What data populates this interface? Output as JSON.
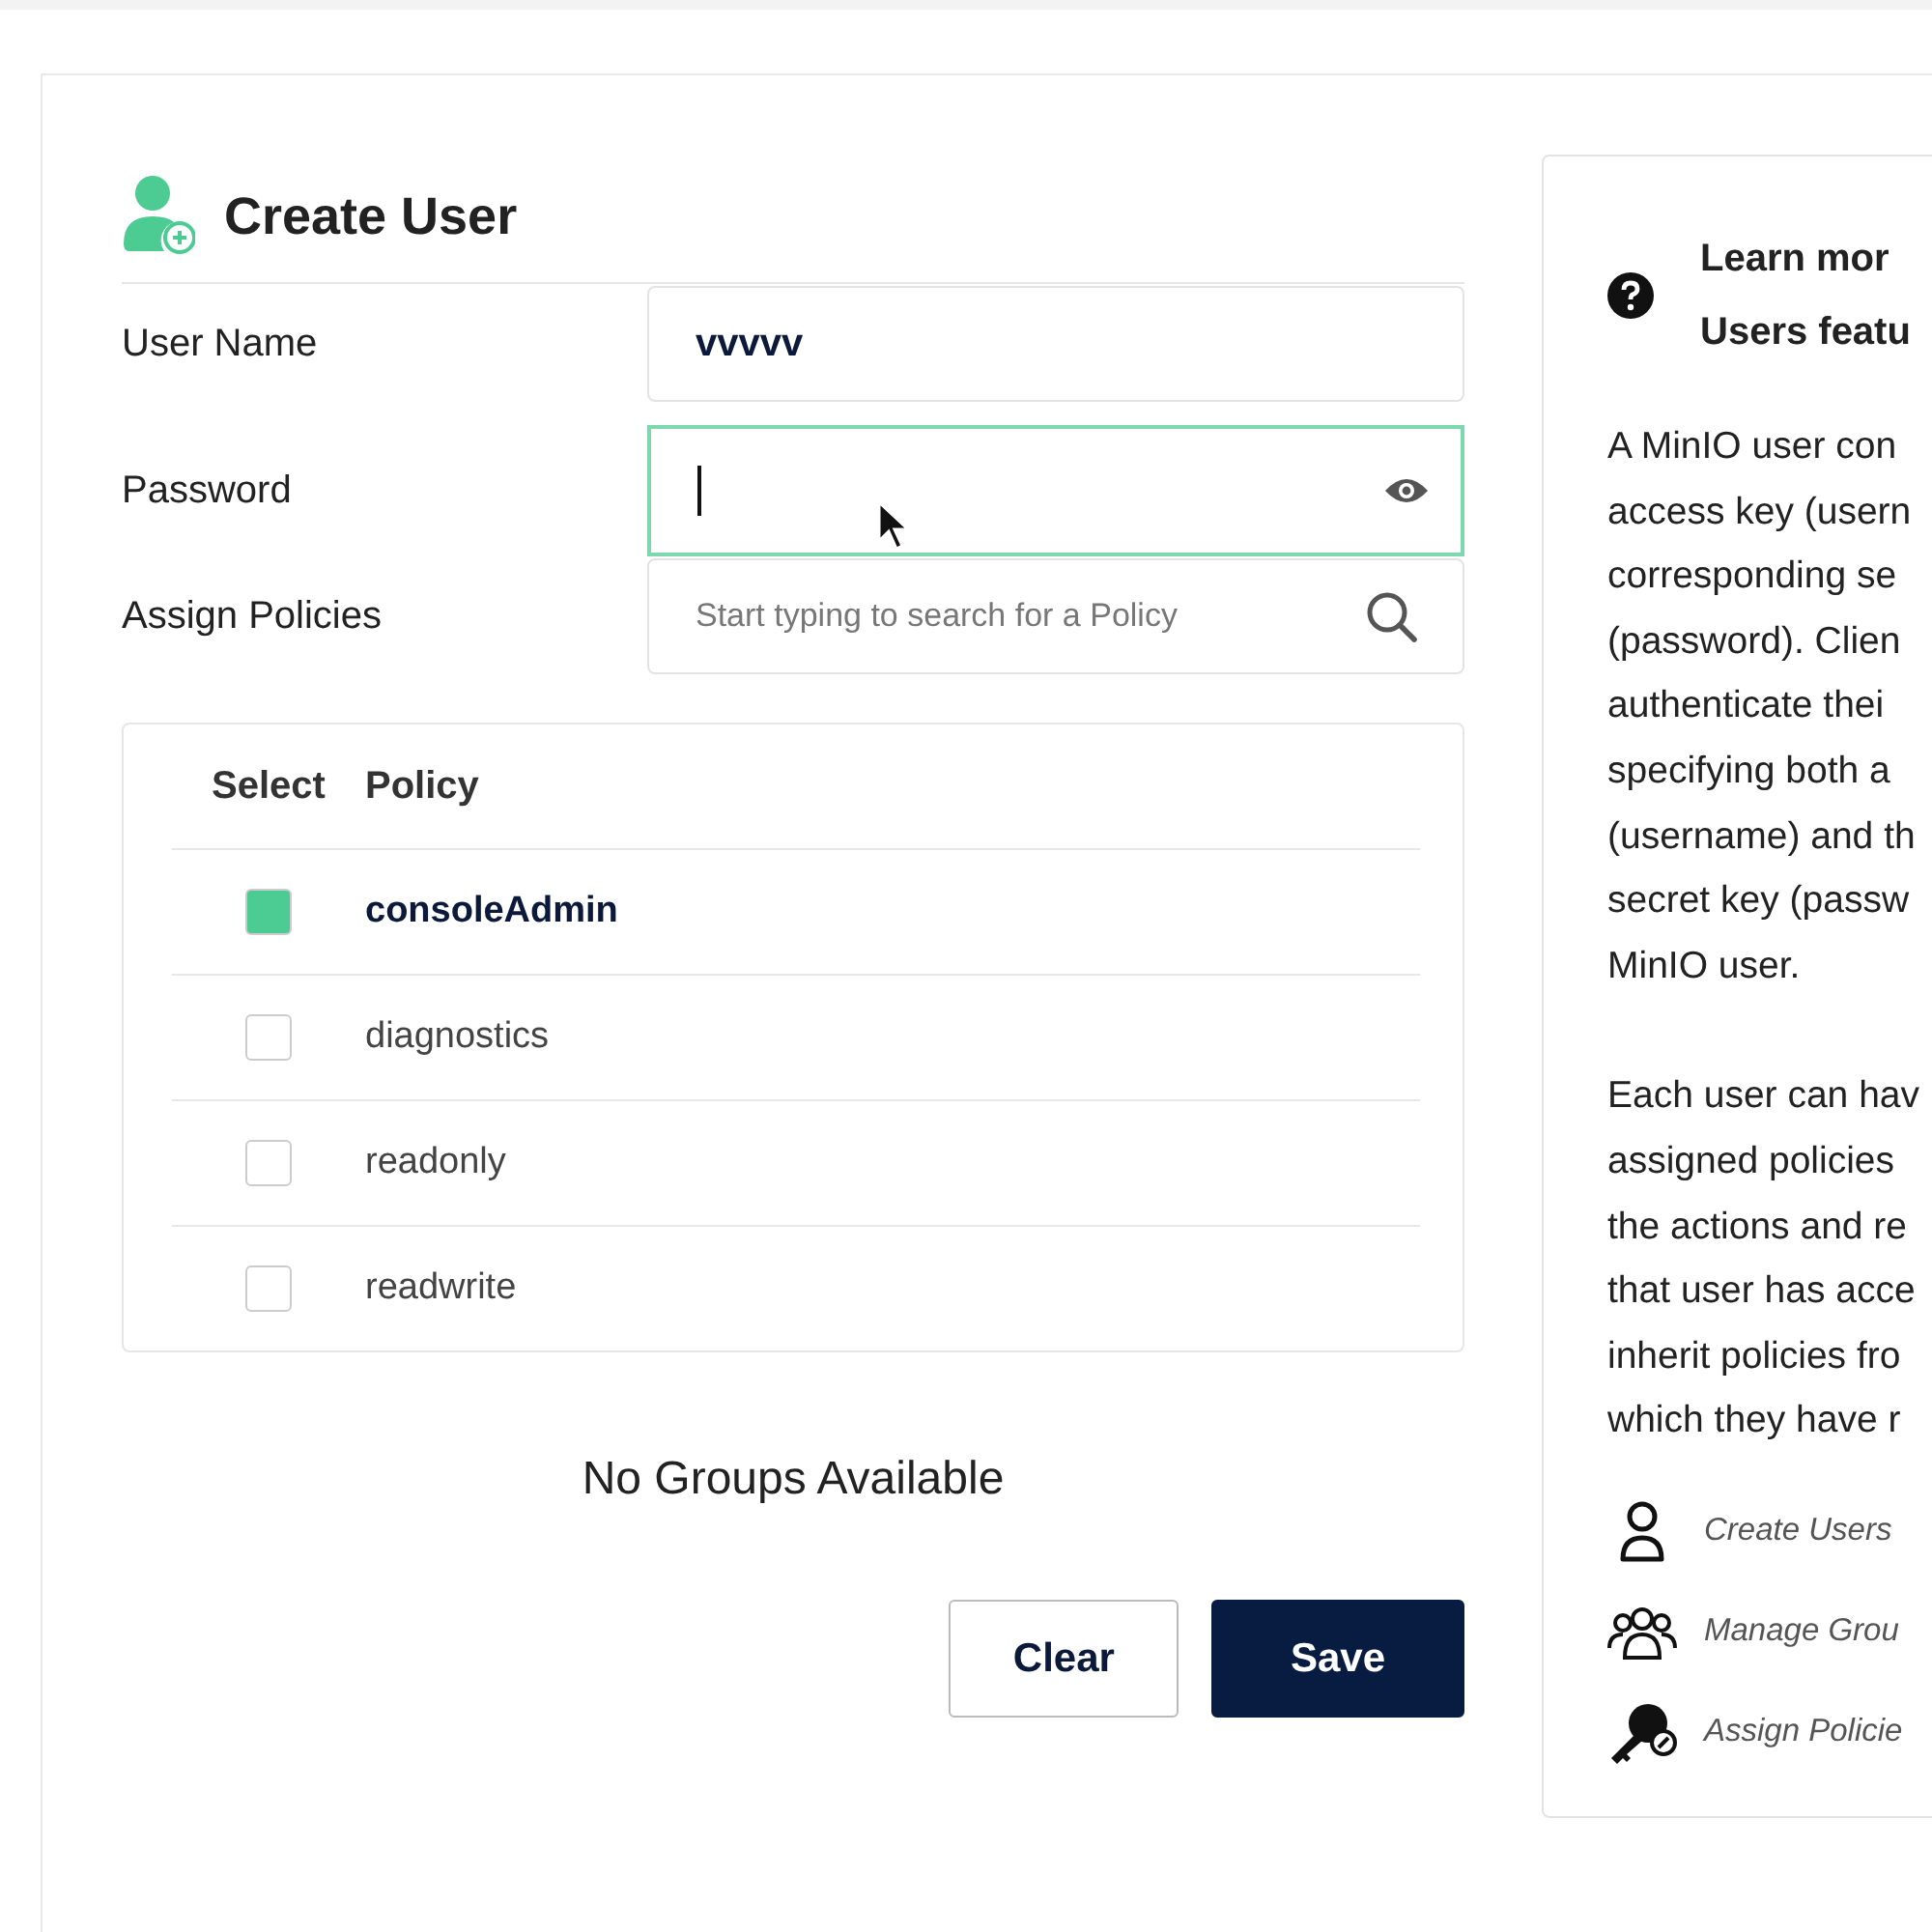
{
  "header": {
    "title": "Create User"
  },
  "form": {
    "user_name": {
      "label": "User Name",
      "value": "vvvvv"
    },
    "password": {
      "label": "Password",
      "focused": true
    },
    "assign_policies": {
      "label": "Assign Policies",
      "placeholder": "Start typing to search for a Policy"
    }
  },
  "policy_table": {
    "columns": [
      "Select",
      "Policy"
    ],
    "rows": [
      {
        "name": "consoleAdmin",
        "checked": true
      },
      {
        "name": "diagnostics",
        "checked": false
      },
      {
        "name": "readonly",
        "checked": false
      },
      {
        "name": "readwrite",
        "checked": false
      }
    ]
  },
  "groups_message": "No Groups Available",
  "buttons": [
    {
      "label": "Clear",
      "kind": "secondary"
    },
    {
      "label": "Save",
      "kind": "primary"
    }
  ],
  "help_panel": {
    "title_lines": [
      "Learn mor",
      "Users featu"
    ],
    "paragraphs": [
      [
        "A MinIO user con",
        "access key (usern",
        "corresponding se",
        "(password). Clien",
        "authenticate thei",
        "specifying both a",
        "(username) and th",
        "secret key (passw",
        "MinIO user."
      ],
      [
        "Each user can hav",
        "assigned policies",
        "the actions and re",
        "that user has acce",
        "inherit policies fro",
        "which they have r"
      ]
    ],
    "links": [
      {
        "label": "Create Users",
        "kind": "user"
      },
      {
        "label": "Manage Grou",
        "kind": "group"
      },
      {
        "label": "Assign Policie",
        "kind": "key"
      }
    ]
  }
}
